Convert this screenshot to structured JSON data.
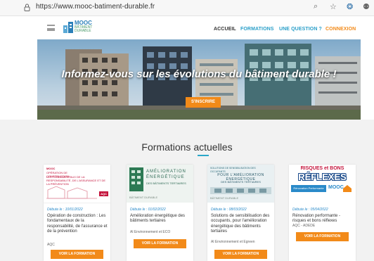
{
  "browser": {
    "url": "https://www.mooc-batiment-durable.fr",
    "icons": [
      "lock-icon",
      "zoom-icon",
      "favorite-icon",
      "extension-icon",
      "profile-icon"
    ]
  },
  "header": {
    "logo": {
      "line1": "MOOC",
      "line2": "BÂTIMENT",
      "line3": "DURABLE"
    },
    "nav": [
      {
        "label": "ACCUEIL",
        "color": "#333333"
      },
      {
        "label": "FORMATIONS",
        "color": "#2a9fc9"
      },
      {
        "label": "UNE QUESTION ?",
        "color": "#2a9fc9"
      },
      {
        "label": "CONNEXION",
        "color": "#f28a19"
      }
    ]
  },
  "hero": {
    "title": "Informez-vous sur les évolutions du bâtiment durable !",
    "cta": "S'INSCRIRE"
  },
  "section": {
    "title": "Formations actuelles"
  },
  "cards": [
    {
      "thumb": {
        "line1": "MOOC",
        "line2": "OPÉRATION DE CONSTRUCTION :",
        "line3": "LES FONDAMENTAUX DE LA RESPONSABILITÉ, DE L'ASSURANCE ET DE LA PRÉVENTION",
        "badge": "AQC"
      },
      "date": "Débute le : 10/01/2022",
      "title": "Opération de construction : Les fondamentaux de la responsabilité, de l'assurance et de la prévention",
      "author": "AQC",
      "button": "VOIR LA FORMATION"
    },
    {
      "thumb": {
        "line1": "AMÉLIORATION",
        "line2": "ÉNERGÉTIQUE",
        "line3": "DES BÂTIMENTS TERTIAIRES",
        "badge": "BÂTIMENT DURABLE"
      },
      "date": "Débute le : 01/02/2022",
      "title": "Amélioration énergétique des bâtiments tertiaires",
      "author": "Al Environnement et ECO",
      "button": "VOIR LA FORMATION"
    },
    {
      "thumb": {
        "line1": "SOLUTIONS DE SENSIBILISATION DES OCCUPANTS",
        "line2": "POUR L'AMÉLIORATION ÉNERGÉTIQUE",
        "line3": "DES BÂTIMENTS TERTIAIRES",
        "badge": "BÂTIMENT DURABLE"
      },
      "date": "Débute le : 08/03/2022",
      "title": "Solutions de sensibilisation des occupants, pour l'amélioration énergétique des bâtiments tertiaires",
      "author": "Al Environnement et Egreen",
      "button": "VOIR LA FORMATION"
    },
    {
      "thumb": {
        "line1": "RISQUES et BONS",
        "line2": "RÉFLEXES",
        "line3": "Rénovation Performante",
        "badge": "MOOC"
      },
      "date": "Débute le : 05/04/2022",
      "title": "Rénovation performante - risques et bons réflexes",
      "author": "AQC - ADEDE",
      "button": "VOIR LA FORMATION"
    }
  ]
}
